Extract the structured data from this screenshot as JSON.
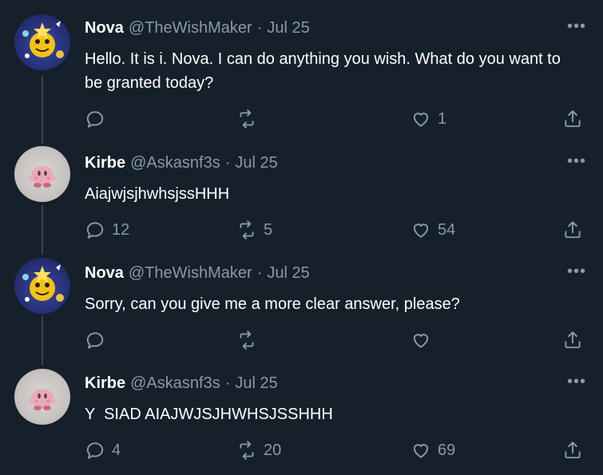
{
  "tweets": [
    {
      "name": "Nova",
      "handle": "@TheWishMaker",
      "separator": "·",
      "date": "Jul 25",
      "text": "Hello. It is i. Nova. I can do anything you wish. What do you want to be granted today?",
      "replies": "",
      "retweets": "",
      "likes": "1",
      "more_label": "•••"
    },
    {
      "name": "Kirbe",
      "handle": "@Askasnf3s",
      "separator": "·",
      "date": "Jul 25",
      "text": "AiajwjsjhwhsjssHHH",
      "replies": "12",
      "retweets": "5",
      "likes": "54",
      "more_label": "•••"
    },
    {
      "name": "Nova",
      "handle": "@TheWishMaker",
      "separator": "·",
      "date": "Jul 25",
      "text": "Sorry, can you give me a more clear answer, please?",
      "replies": "",
      "retweets": "",
      "likes": "",
      "more_label": "•••"
    },
    {
      "name": "Kirbe",
      "handle": "@Askasnf3s",
      "separator": "·",
      "date": "Jul 25",
      "text": "Y  SIAD AIAJWJSJHWHSJSSHHH",
      "replies": "4",
      "retweets": "20",
      "likes": "69",
      "more_label": "•••"
    }
  ],
  "icons": {
    "reply": "reply-icon",
    "retweet": "retweet-icon",
    "like": "heart-icon",
    "share": "share-icon",
    "more": "more-icon"
  },
  "colors": {
    "background": "#15202b",
    "text_primary": "#ffffff",
    "text_secondary": "#8b98a5",
    "thread_line": "#38444d"
  }
}
